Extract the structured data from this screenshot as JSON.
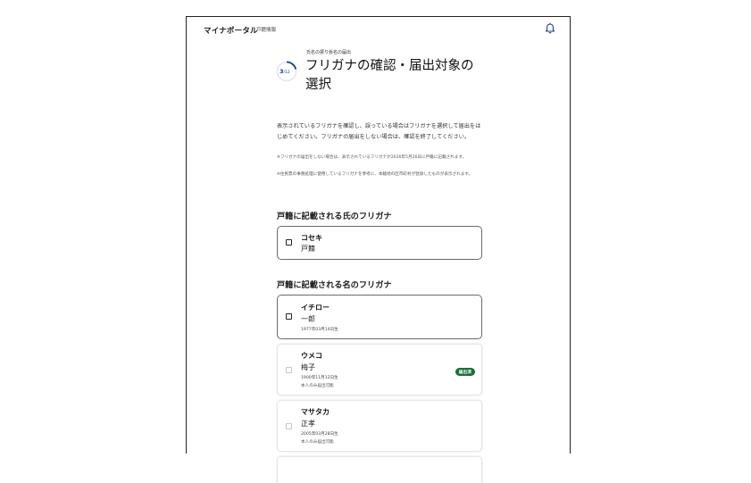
{
  "app": {
    "brand": "マイナポータル",
    "subbrand": "戸籍情報"
  },
  "page": {
    "eyebrow": "氏名の振り仮名の届出",
    "step_current": "3",
    "step_total": "/12",
    "title": "フリガナの確認・届出対象の選択",
    "description": "表示されているフリガナを確認し、誤っている場合はフリガナを選択して届出をはじめてください。フリガナの届出をしない場合は、確認を終了してください。",
    "note1": "※フリガナの届出をしない場合は、表示されているフリガナが2026年5月26日に戸籍に記載されます。",
    "note2": "※住民票の事務処理に使用しているフリガナを参考に、本籍地の区市町村が登録したものが表示されます。"
  },
  "surname_section": {
    "heading": "戸籍に記載される氏のフリガナ",
    "items": [
      {
        "kana": "コセキ",
        "kanji": "戸籍"
      }
    ]
  },
  "given_section": {
    "heading": "戸籍に記載される名のフリガナ",
    "items": [
      {
        "kana": "イチロー",
        "kanji": "一郎",
        "date": "1977年03月14日生",
        "sub": "",
        "badge": ""
      },
      {
        "kana": "ウメコ",
        "kanji": "梅子",
        "date": "1900年11月12日生",
        "sub": "本人のみ届出可能",
        "badge": "届出済"
      },
      {
        "kana": "マサタカ",
        "kanji": "正孝",
        "date": "2005年03月28日生",
        "sub": "本人のみ届出可能",
        "badge": ""
      }
    ]
  },
  "colors": {
    "accent": "#1e3a8a",
    "badge": "#1b6e3a"
  }
}
